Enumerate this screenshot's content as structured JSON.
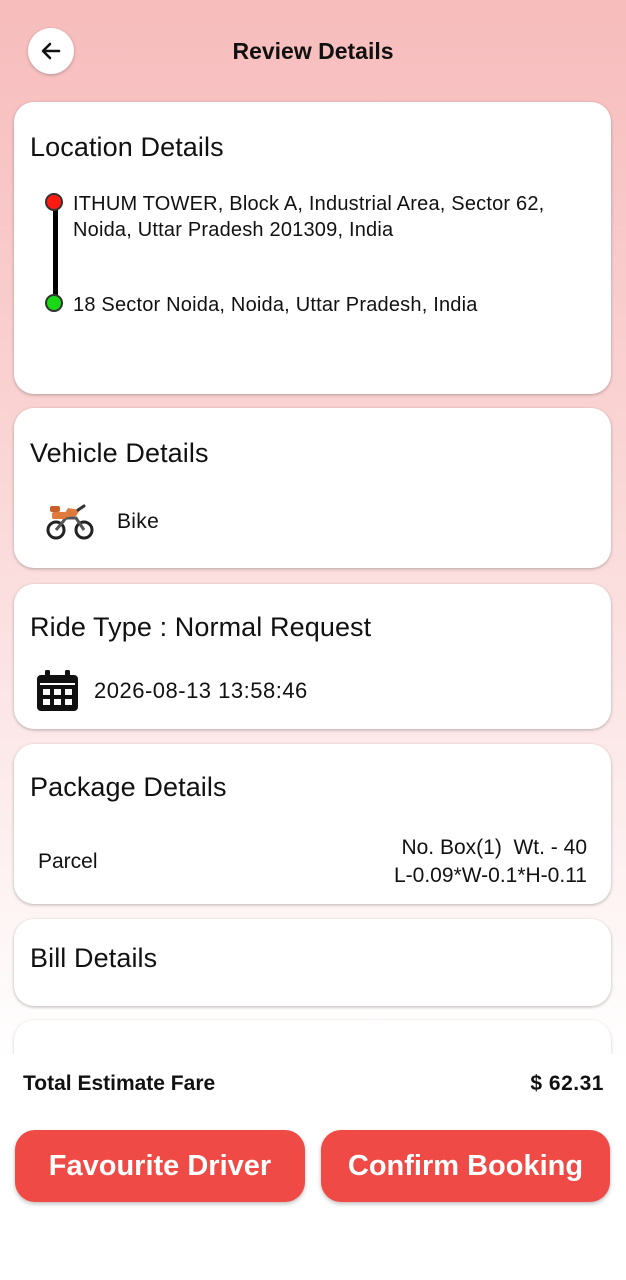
{
  "header": {
    "title": "Review Details"
  },
  "location": {
    "heading": "Location Details",
    "pickup": "ITHUM TOWER, Block A, Industrial Area, Sector 62, Noida, Uttar Pradesh 201309, India",
    "drop": "18 Sector Noida, Noida, Uttar Pradesh, India"
  },
  "vehicle": {
    "heading": "Vehicle Details",
    "name": "Bike",
    "icon": "bike-icon"
  },
  "ride": {
    "heading": "Ride Type : Normal Request",
    "datetime": "2026-08-13 13:58:46",
    "icon": "calendar-icon"
  },
  "package": {
    "heading": "Package Details",
    "type": "Parcel",
    "boxes": "No. Box(1)  Wt. - 40",
    "dimensions": "L-0.09*W-0.1*H-0.11"
  },
  "bill": {
    "heading": "Bill Details"
  },
  "footer": {
    "total_label": "Total Estimate Fare",
    "total_value": "$ 62.31",
    "favourite_label": "Favourite Driver",
    "confirm_label": "Confirm Booking"
  },
  "colors": {
    "accent": "#ef4a45",
    "pickup_dot": "#ff1a12",
    "drop_dot": "#18d818"
  }
}
